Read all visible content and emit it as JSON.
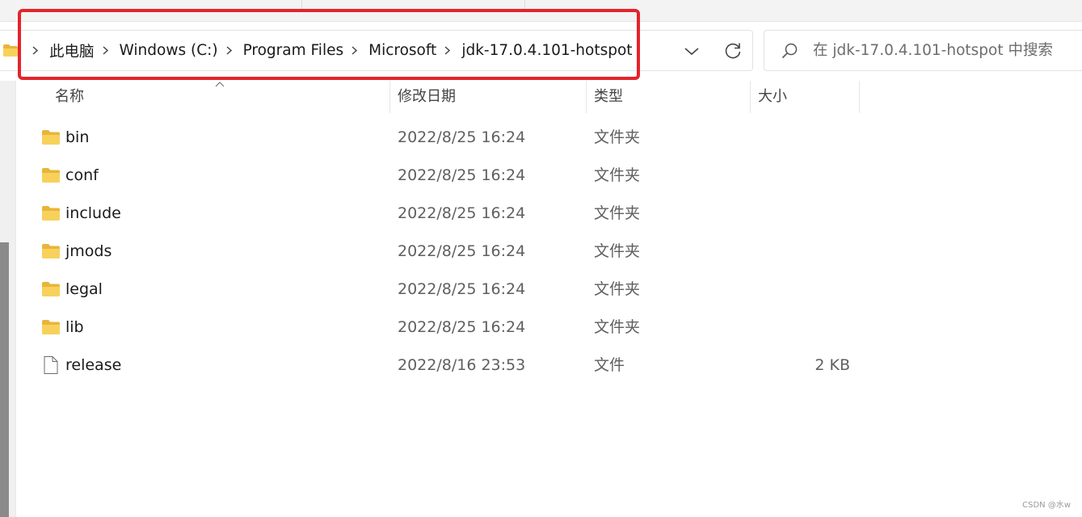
{
  "breadcrumb": {
    "items": [
      "此电脑",
      "Windows (C:)",
      "Program Files",
      "Microsoft",
      "jdk-17.0.4.101-hotspot"
    ]
  },
  "search": {
    "placeholder": "在 jdk-17.0.4.101-hotspot 中搜索"
  },
  "columns": {
    "name": "名称",
    "modified": "修改日期",
    "type": "类型",
    "size": "大小"
  },
  "files": [
    {
      "name": "bin",
      "modified": "2022/8/25 16:24",
      "type": "文件夹",
      "size": "",
      "icon": "folder-icon"
    },
    {
      "name": "conf",
      "modified": "2022/8/25 16:24",
      "type": "文件夹",
      "size": "",
      "icon": "folder-icon"
    },
    {
      "name": "include",
      "modified": "2022/8/25 16:24",
      "type": "文件夹",
      "size": "",
      "icon": "folder-icon"
    },
    {
      "name": "jmods",
      "modified": "2022/8/25 16:24",
      "type": "文件夹",
      "size": "",
      "icon": "folder-icon"
    },
    {
      "name": "legal",
      "modified": "2022/8/25 16:24",
      "type": "文件夹",
      "size": "",
      "icon": "folder-icon"
    },
    {
      "name": "lib",
      "modified": "2022/8/25 16:24",
      "type": "文件夹",
      "size": "",
      "icon": "folder-icon"
    },
    {
      "name": "release",
      "modified": "2022/8/16 23:53",
      "type": "文件",
      "size": "2 KB",
      "icon": "file-icon"
    }
  ],
  "watermark": "CSDN @水w",
  "colors": {
    "highlight": "#e5232b",
    "folder": "#f4c542"
  }
}
